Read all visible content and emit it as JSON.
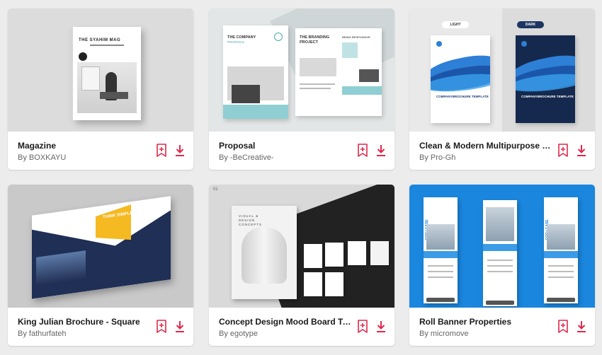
{
  "cards": [
    {
      "title": "Magazine",
      "author": "By BOXKAYU",
      "thumb_text": {
        "headline": "THE SYAHIM MAG"
      }
    },
    {
      "title": "Proposal",
      "author": "By -BeCreative-",
      "thumb_text": {
        "page1": "THE COMPANY",
        "page1_sub": "PROPOSAL",
        "page2": "THE BRANDING PROJECT",
        "page2_right": "BEING RESPONSIVE"
      }
    },
    {
      "title": "Clean & Modern Multipurpose Broc...",
      "author": "By Pro-Gh",
      "thumb_text": {
        "light_tag": "LIGHT",
        "dark_tag": "DARK",
        "caption": "COMPANYBROCHURE TEMPLATE"
      }
    },
    {
      "title": "King Julian Brochure - Square",
      "author": "By fathurfateh",
      "thumb_text": {
        "headline": "THINK SIMPLE DESIGN"
      }
    },
    {
      "title": "Concept Design Mood Board Templ...",
      "author": "By egotype",
      "thumb_text": {
        "number": "01",
        "headline": "VISUAL & DESIGN CONCEPTS"
      }
    },
    {
      "title": "Roll Banner Properties",
      "author": "By micromove",
      "thumb_text": {
        "vertical": "FOR LEASE"
      }
    }
  ],
  "colors": {
    "accent": "#e0284b",
    "background": "#ececec"
  },
  "icons": {
    "bookmark": "bookmark-plus-icon",
    "download": "download-icon"
  }
}
